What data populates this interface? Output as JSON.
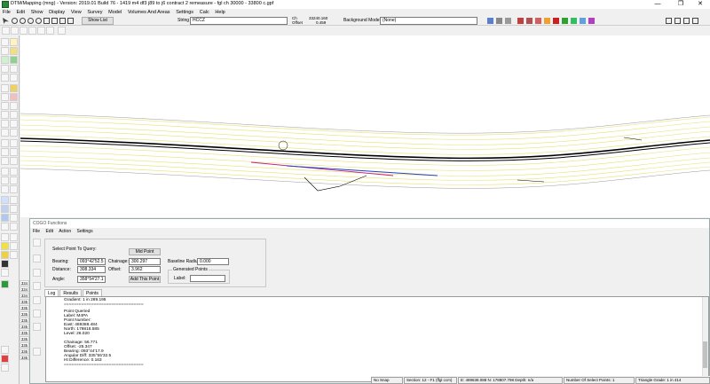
{
  "window": {
    "title": "DTM/Mapping (mng) - Version: 2019.01 Build 76 - 1419 m4 df3 j89 to j6 contract 2 remeasure - fgl ch 30000 - 33800 c.gpf",
    "min": "—",
    "max": "❐",
    "close": "✕"
  },
  "menu": [
    "File",
    "Edit",
    "Show",
    "Display",
    "View",
    "Survey",
    "Model",
    "Volumes And Areas",
    "Settings",
    "Calc",
    "Help"
  ],
  "toolbar": {
    "show_list": "Show List",
    "string_label": "String",
    "string_value": "HCCZ",
    "ch_label": "Ch",
    "offset_label": "Offset",
    "ch_value": "33240.160",
    "offset_value": "0.459",
    "bg_model_label": "Background Model:",
    "bg_model_value": "(None)"
  },
  "cogo": {
    "title": "COGO Functions",
    "menu": [
      "File",
      "Edit",
      "Action",
      "Settings"
    ],
    "select_label": "Select Point To Query:",
    "bearing_label": "Bearing:",
    "bearing_value": "093°42'52.5",
    "distance_label": "Distance:",
    "distance_value": "308.334",
    "angle_label": "Angle:",
    "angle_value": "358°54'27.1",
    "chainage_label": "Chainage:",
    "chainage_value": "300.297",
    "offset_label": "Offset:",
    "offset_value": "3.962",
    "mid_point": "Mid Point",
    "add_this_point": "Add This Point",
    "baseline_radius_label": "Baseline Radius",
    "baseline_radius_value": "0.000",
    "generated_points_label": "Generated Points",
    "gp_label": "Label:",
    "gp_label_value": "",
    "tabs": [
      "Log",
      "Results",
      "Points"
    ],
    "log": [
      "Gradient:  1 in 289.195",
      "================================",
      "Point Queried",
      "Label: M4PA",
      "Point Number:",
      "East:  489388.484",
      "North: 178818.585",
      "Level: 26.020",
      "",
      "Chainage: 56.771",
      "Offset:  -25.347",
      "Bearing: 093°44'17.9",
      "Angular Diff: 335°55'32.5",
      "Ht Difference:  0.163",
      "================================"
    ]
  },
  "row_numbers": [
    "334",
    "334",
    "334",
    "335",
    "335",
    "335",
    "335",
    "335",
    "335",
    "335",
    "335",
    "335",
    "335",
    "335"
  ],
  "status": {
    "snap": "No Snap",
    "section": "Section: 12 - F1 (ffgl ccm)",
    "coords": "E: 489638.088  N: 178807.798  Depth: n/a",
    "select": "Number Of Select Points: 1",
    "triangle": "Triangle Grade: 1 in 414"
  },
  "colors": {
    "accent": "#2a8a3a",
    "road_yellow": "#e8e070",
    "road_black": "#000000",
    "magenta": "#c0208a",
    "blue": "#2040c0"
  }
}
